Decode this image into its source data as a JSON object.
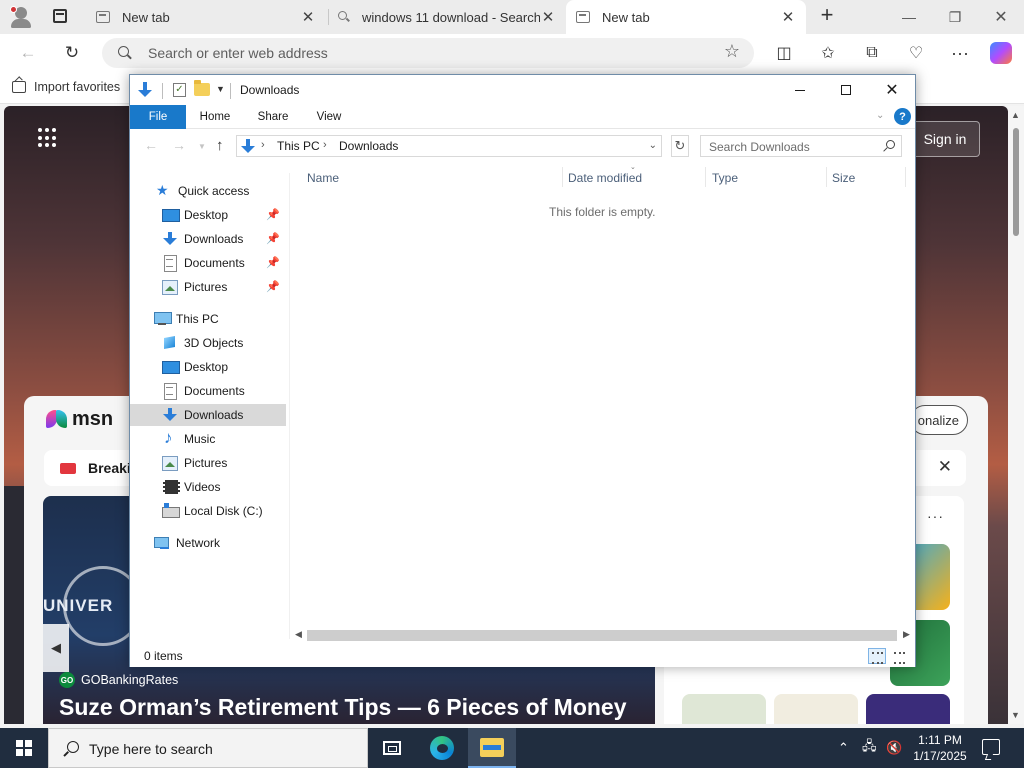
{
  "browser": {
    "tabs": [
      {
        "title": "New tab",
        "active": false
      },
      {
        "title": "windows 11 download - Search",
        "active": false
      },
      {
        "title": "New tab",
        "active": true
      }
    ],
    "address_placeholder": "Search or enter web address",
    "favorites_bar": {
      "import_label": "Import favorites"
    }
  },
  "newtab": {
    "signin_label": "Sign in",
    "msn_logo": "msn",
    "personalize_label": "onalize",
    "breaking_label": "Breakin",
    "hero": {
      "logo_text": "UNIVER",
      "source_badge": "GO",
      "source": "GOBankingRates",
      "headline": "Suze Orman’s Retirement Tips — 6 Pieces of Money"
    }
  },
  "explorer": {
    "title": "Downloads",
    "ribbon_tabs": [
      "File",
      "Home",
      "Share",
      "View"
    ],
    "help_label": "?",
    "breadcrumb": [
      "This PC",
      "Downloads"
    ],
    "search_placeholder": "Search Downloads",
    "nav": {
      "quick_access": "Quick access",
      "quick_items": [
        "Desktop",
        "Downloads",
        "Documents",
        "Pictures"
      ],
      "this_pc": "This PC",
      "pc_items": [
        "3D Objects",
        "Desktop",
        "Documents",
        "Downloads",
        "Music",
        "Pictures",
        "Videos",
        "Local Disk (C:)"
      ],
      "network": "Network",
      "selected": "Downloads"
    },
    "columns": [
      "Name",
      "Date modified",
      "Type",
      "Size"
    ],
    "empty_message": "This folder is empty.",
    "status": "0 items"
  },
  "taskbar": {
    "search_placeholder": "Type here to search",
    "time": "1:11 PM",
    "date": "1/17/2025"
  },
  "colors": {
    "accent": "#1979ca",
    "taskbar": "#202d3f",
    "selection": "#d9d9d9"
  }
}
